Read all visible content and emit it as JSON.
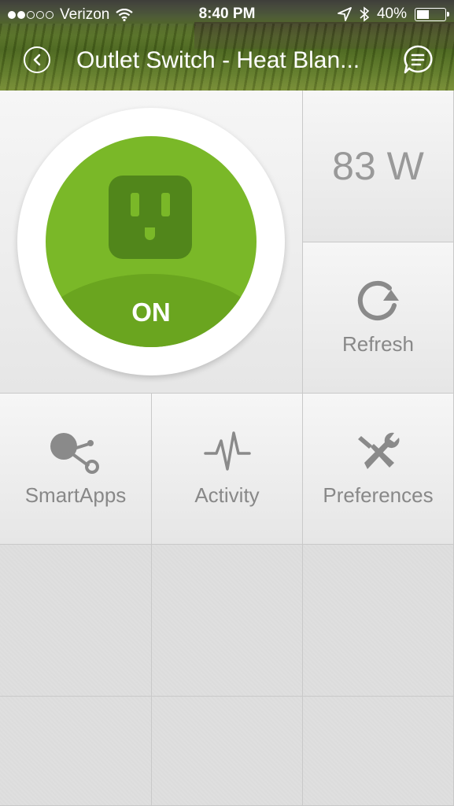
{
  "status_bar": {
    "carrier": "Verizon",
    "time": "8:40 PM",
    "battery": "40%",
    "battery_level": 0.4,
    "icons": [
      "signal-dots-icon",
      "wifi-icon",
      "location-arrow-icon",
      "bluetooth-icon",
      "battery-icon"
    ]
  },
  "nav": {
    "title": "Outlet Switch - Heat Blan...",
    "back_icon": "back-circle-icon",
    "messages_icon": "chat-bubble-icon"
  },
  "switch": {
    "state": "ON",
    "icon": "outlet-icon",
    "color_on": "#7ab828"
  },
  "power": {
    "value": "83 W"
  },
  "refresh": {
    "label": "Refresh",
    "icon": "refresh-icon"
  },
  "tiles": {
    "smartapps": {
      "label": "SmartApps",
      "icon": "smartapps-icon"
    },
    "activity": {
      "label": "Activity",
      "icon": "activity-pulse-icon"
    },
    "preferences": {
      "label": "Preferences",
      "icon": "wrench-screwdriver-icon"
    }
  }
}
